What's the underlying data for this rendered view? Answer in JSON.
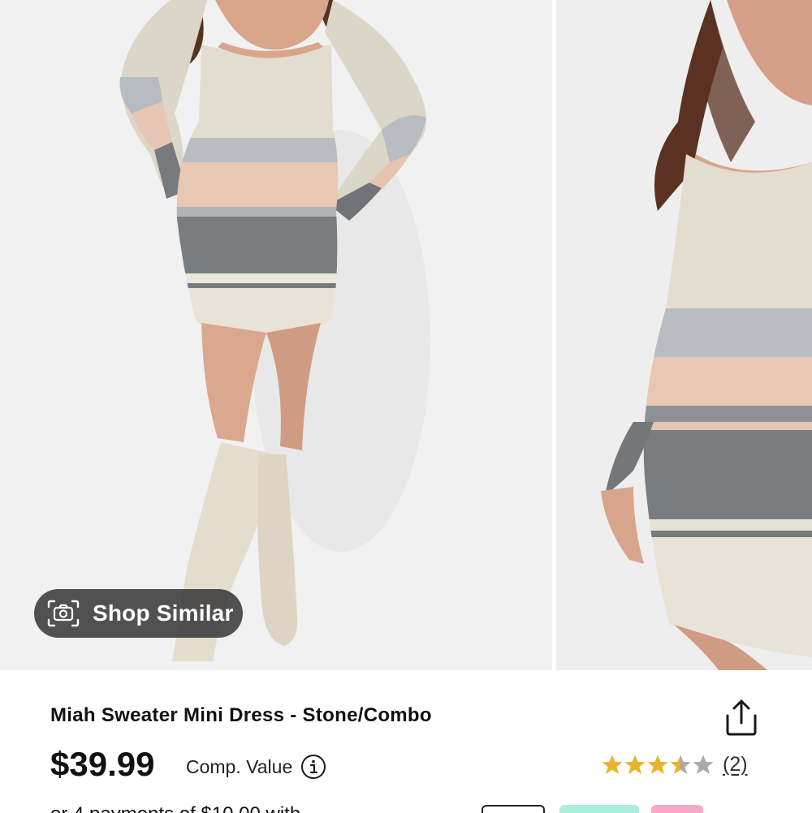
{
  "gallery": {
    "images": [
      {
        "name": "product-photo-front",
        "description": "Model wearing striped ribbed sweater mini dress with knee-high cream boots"
      },
      {
        "name": "product-photo-side",
        "description": "Close-up side view of the striped sweater mini dress"
      }
    ],
    "shop_similar_label": "Shop Similar"
  },
  "product": {
    "title": "Miah Sweater Mini Dress - Stone/Combo",
    "price": "$39.99",
    "comp_value_label": "Comp. Value",
    "rating": 3.5,
    "rating_max": 5,
    "review_count": "(2)",
    "installment_text_partial": "or 4 payments of $10.00 with"
  },
  "icons": {
    "camera": "camera-icon",
    "info": "info-icon",
    "share": "share-icon",
    "star": "star-icon"
  },
  "colors": {
    "star_filled": "#E6B52E",
    "star_empty": "#A9A9A9",
    "pill_green": "#A9EEDC",
    "pill_pink": "#F7A9C9"
  }
}
